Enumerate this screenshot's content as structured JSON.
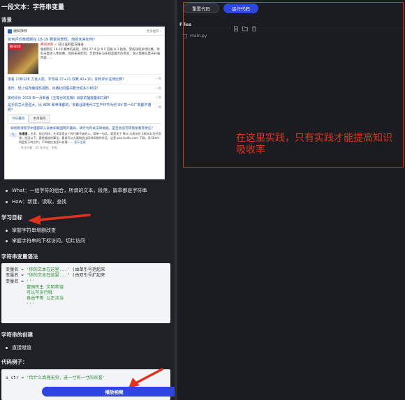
{
  "lesson": {
    "title": "一段文本：字符串变量",
    "bg_heading": "背景",
    "screenshot": {
      "brand": "编辑推荐",
      "more": "更多推荐 ›",
      "q1": "如何评价詹姆斯在 18-19 赛季的表现，他的未来如何？",
      "feature_who": "腾讯体育 ✓",
      "feature_who_tag": "已认证的官方账号",
      "feature_text": "詹姆斯在 18-19 赛季的表现，场均 27.4 分 8.5 篮板 8.3 助攻，受伤缺席多场比赛，球队未能进入季后赛。他的未来如何，年龄增长与伤病是最大的考验，湖人需要在夏天补强阵容……",
      "feature_tag": "腾讯体育",
      "rows": [
        {
          "text": "接着 118/108 力克火箭，字母哥 27+21 双赛 42+10，如何评价这场比赛？",
          "time": "一周"
        },
        {
          "text": "重庆、轻小说改编成影视剧，出版社的图书要分成多少利润？",
          "time": "一周"
        },
        {
          "text": "如何评价 2019 年一月新番《五等分的花嫁》目前的播放量和口碑？",
          "time": "一周"
        },
        {
          "text": "是手机芯片更强大，比 ARM 和苹果都的，安森谷歌电代工生产环节为何 OV 等一众厂商都不遵照？",
          "time": "一周"
        }
      ],
      "tab_today": "今日最热",
      "tab_month": "本月最热",
      "q2": "如何看待现学中国部研入表委如果国两外籍局，请行为有关法律依据，是否会追究转看接教育责任？",
      "ans_badge": "TL",
      "ans_author": "张漫漫",
      "ans_text": "艺术、前沿科技，艺术家是这个时代最不缺的人。简单一句话，就是关于 Mos 与表示的 180mb 的开资源，找没以下，要依据谁的算法，看谁可以大量制造出同样风格的作品，这是 pan.baidu.com 下载，用 Dtem 网盘显示的文件，不知道应该怎么处理……",
      "ans_link": "显示全部",
      "actions": "· 关注问题  · 32 条评论  · 举报"
    },
    "bullets": [
      "What：一组字符的组合，所谓的文本，段落，篇章都是字符串",
      "How：新建，读取，查找"
    ],
    "goals_heading": "学习目标",
    "goals": [
      "掌握字符串增删改查",
      "掌握字符串的下标访问，切片访问"
    ],
    "syntax_heading": "字符串变量语法",
    "syntax_lines": [
      {
        "pre": "变量名 = ",
        "str": "'你的文本在这里...'",
        "post": " (由单引号括起来"
      },
      {
        "pre": "变量名 = ",
        "str": "\"你的文本在这里...\"",
        "post": " (由双引号扩起来"
      },
      {
        "pre": "变量名 = ",
        "str": "'''",
        "post": ""
      },
      {
        "pre": "        ",
        "str": "富强民主 文明和谐",
        "post": ""
      },
      {
        "pre": "        ",
        "str": "可以写多行哦",
        "post": ""
      },
      {
        "pre": "        ",
        "str": "自由平等 公正法治",
        "post": ""
      },
      {
        "pre": "        ",
        "str": "'''",
        "post": ""
      }
    ],
    "create_heading": "字符串的创建",
    "create_bullet": "直接赋值",
    "example_heading": "代码例子：",
    "example_line": {
      "pre": "a_str = ",
      "str": "'恰什么真理无穷，进一寸有一寸的欢喜'"
    },
    "play_label": "播放视频"
  },
  "editor": {
    "reset_label": "重置代码",
    "run_label": "运行代码",
    "files_label": "Files",
    "file_name": "main.py",
    "note": "在这里实践，只有实践才能提高知识吸收率"
  },
  "colors": {
    "accent": "#2f45e0",
    "annotation": "#e0331f",
    "pane_bg": "#202126",
    "editor_bg": "#1b1c22"
  },
  "icons": [
    "new-file-icon",
    "new-folder-icon",
    "delete-icon",
    "python-file-icon",
    "red-arrow-icon"
  ]
}
